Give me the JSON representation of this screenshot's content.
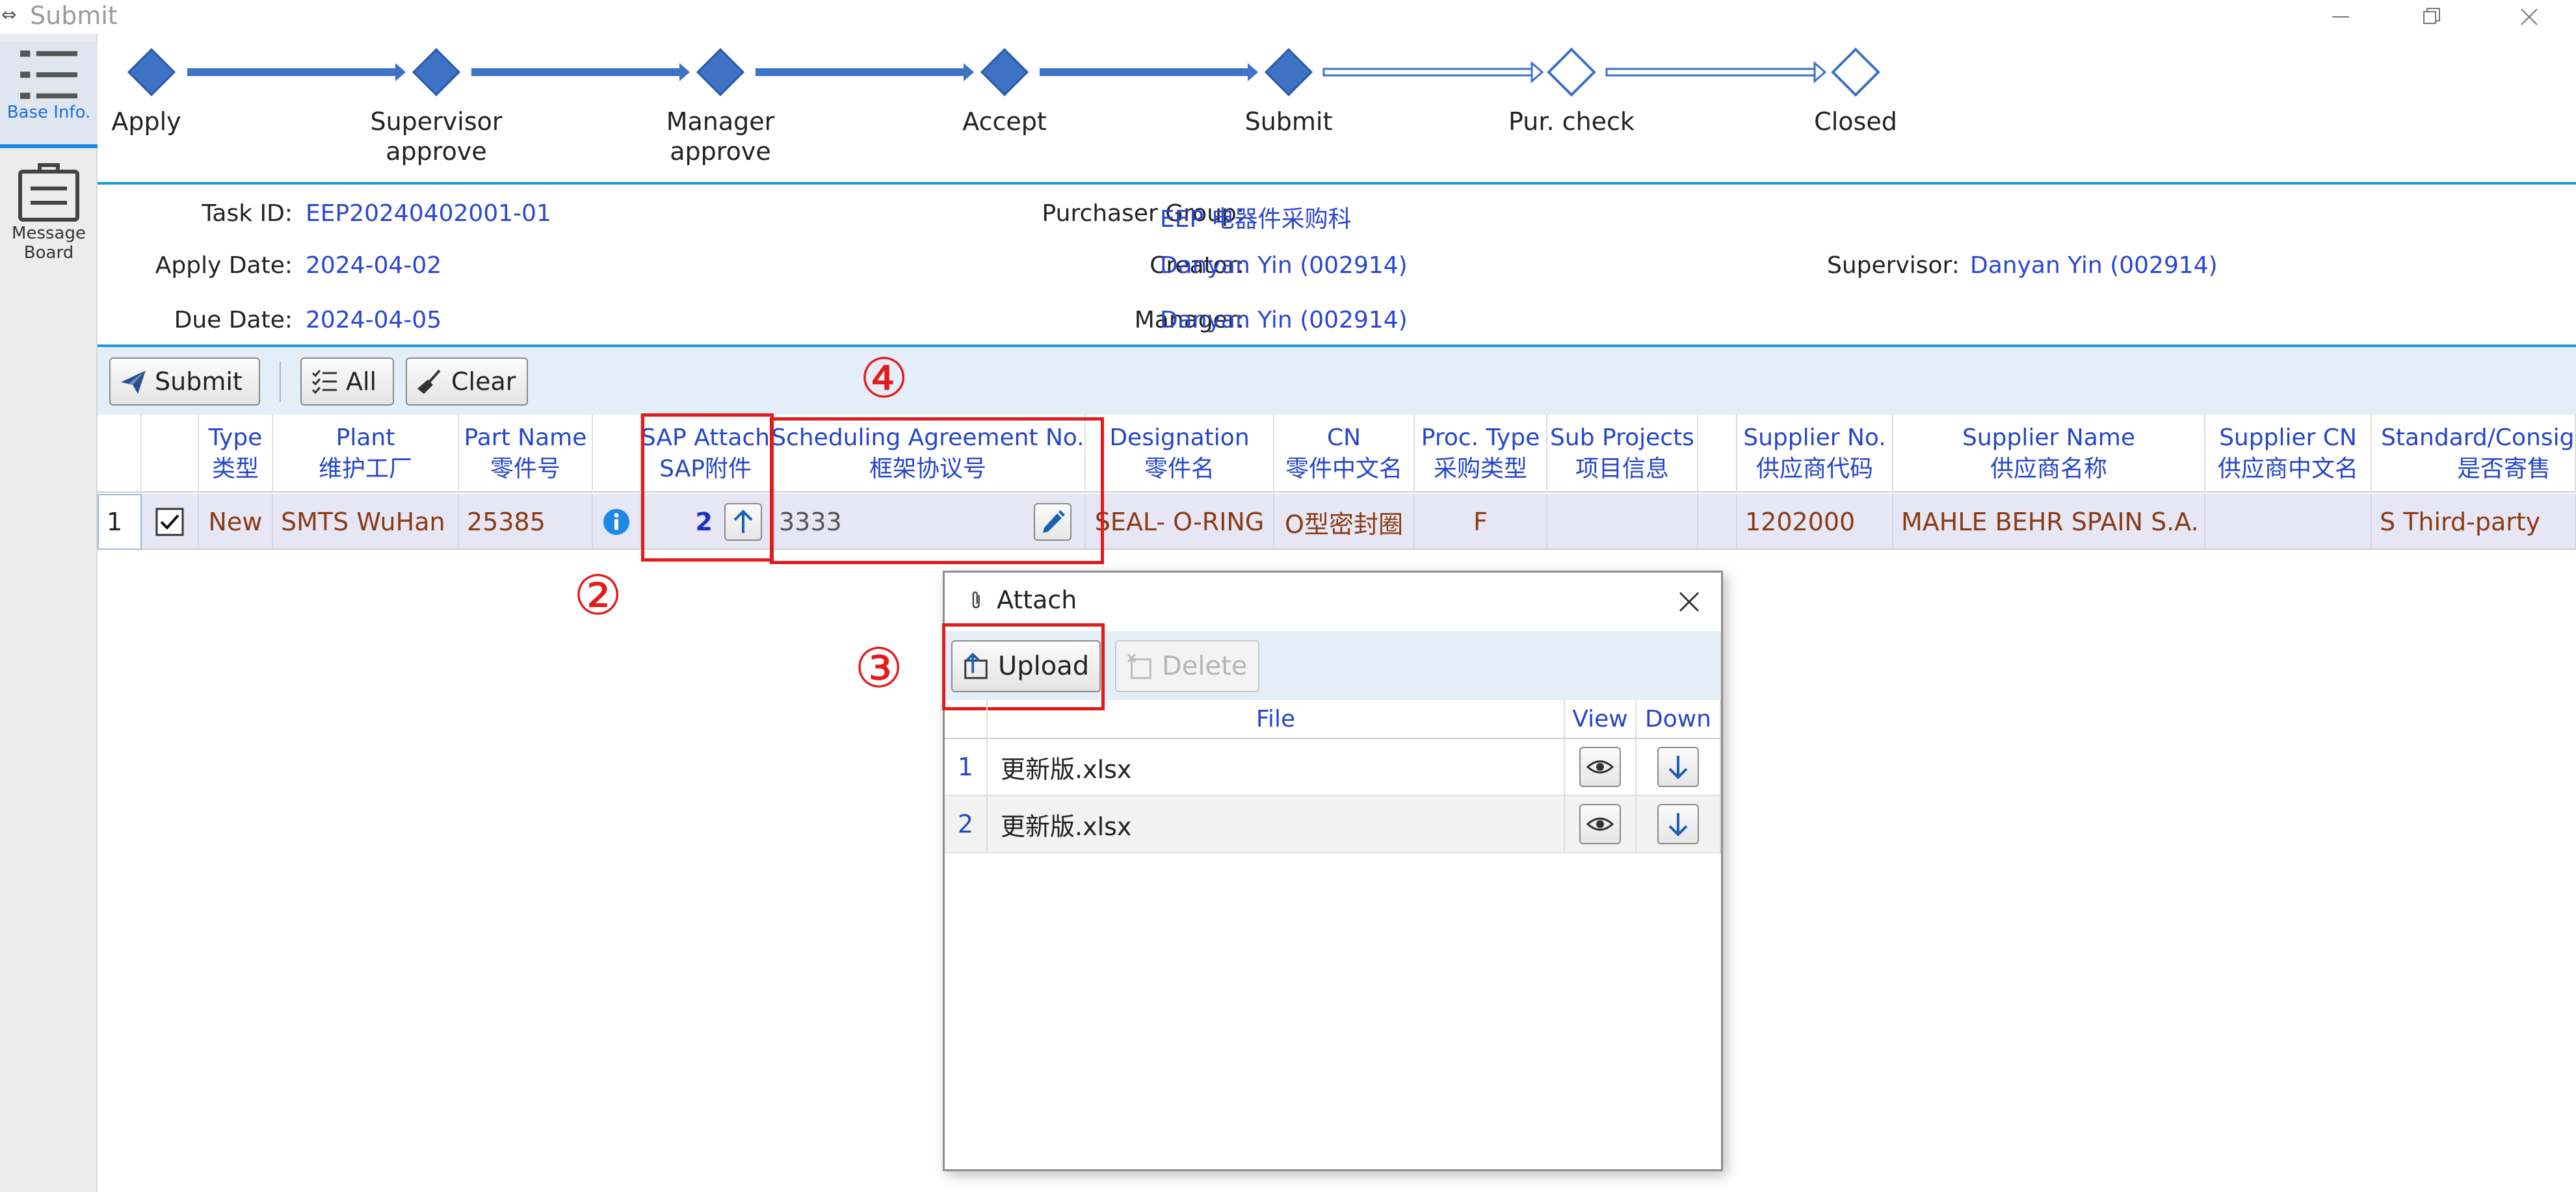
{
  "window": {
    "title": "Submit",
    "controls": [
      "minimize",
      "restore",
      "close"
    ]
  },
  "sidebar": {
    "items": [
      {
        "label": "Base Info.",
        "icon": "list-icon",
        "active": true
      },
      {
        "label": "Message\nBoard",
        "icon": "clipboard-icon",
        "active": false
      }
    ]
  },
  "workflow": {
    "steps": [
      {
        "label": "Apply",
        "done": true
      },
      {
        "label": "Supervisor\napprove",
        "done": true
      },
      {
        "label": "Manager\napprove",
        "done": true
      },
      {
        "label": "Accept",
        "done": true
      },
      {
        "label": "Submit",
        "done": true
      },
      {
        "label": "Pur. check",
        "done": false
      },
      {
        "label": "Closed",
        "done": false
      }
    ]
  },
  "info": {
    "task_id_label": "Task ID:",
    "task_id": "EEP20240402001-01",
    "apply_date_label": "Apply Date:",
    "apply_date": "2024-04-02",
    "due_date_label": "Due Date:",
    "due_date": "2024-04-05",
    "purchaser_group_label": "Purchaser Group:",
    "purchaser_group": "EEP 电器件采购科",
    "creator_label": "Creator:",
    "creator": "Danyan Yin (002914)",
    "manager_label": "Manager:",
    "manager": "Danyan Yin (002914)",
    "supervisor_label": "Supervisor:",
    "supervisor": "Danyan Yin (002914)"
  },
  "toolbar": {
    "submit_label": "Submit",
    "all_label": "All",
    "clear_label": "Clear"
  },
  "grid": {
    "columns": [
      {
        "key": "rownum",
        "line1": "",
        "line2": ""
      },
      {
        "key": "check",
        "line1": "",
        "line2": ""
      },
      {
        "key": "type",
        "line1": "Type",
        "line2": "类型"
      },
      {
        "key": "plant",
        "line1": "Plant",
        "line2": "维护工厂"
      },
      {
        "key": "part",
        "line1": "Part Name",
        "line2": "零件号"
      },
      {
        "key": "info",
        "line1": "",
        "line2": ""
      },
      {
        "key": "sap",
        "line1": "SAP Attach",
        "line2": "SAP附件"
      },
      {
        "key": "sched",
        "line1": "Scheduling Agreement No.",
        "line2": "框架协议号"
      },
      {
        "key": "desig",
        "line1": "Designation",
        "line2": "零件名"
      },
      {
        "key": "cn",
        "line1": "CN",
        "line2": "零件中文名"
      },
      {
        "key": "proc",
        "line1": "Proc. Type",
        "line2": "采购类型"
      },
      {
        "key": "sub",
        "line1": "Sub Projects",
        "line2": "项目信息"
      },
      {
        "key": "blank",
        "line1": "",
        "line2": ""
      },
      {
        "key": "supno",
        "line1": "Supplier No.",
        "line2": "供应商代码"
      },
      {
        "key": "supname",
        "line1": "Supplier Name",
        "line2": "供应商名称"
      },
      {
        "key": "supcn",
        "line1": "Supplier CN",
        "line2": "供应商中文名"
      },
      {
        "key": "std",
        "line1": "Standard/Consign",
        "line2": "是否寄售"
      }
    ],
    "rows": [
      {
        "rownum": "1",
        "checked": true,
        "type": "New",
        "plant": "SMTS WuHan",
        "part": "25385",
        "sap_count": "2",
        "sched": "3333",
        "desig": "SEAL- O-RING",
        "cn": "O型密封圈",
        "proc": "F",
        "sub": "",
        "supno": "1202000",
        "supname": "MAHLE BEHR SPAIN S.A.",
        "supcn": "",
        "std": "S Third-party"
      }
    ]
  },
  "annotations": {
    "n2": "②",
    "n3": "③",
    "n4": "④"
  },
  "dialog": {
    "title": "Attach",
    "upload_label": "Upload",
    "delete_label": "Delete",
    "columns": {
      "file": "File",
      "view": "View",
      "down": "Down"
    },
    "files": [
      {
        "num": "1",
        "name": "更新版.xlsx"
      },
      {
        "num": "2",
        "name": "更新版.xlsx"
      }
    ]
  },
  "colors": {
    "accent": "#1e9bd7",
    "link_blue": "#2a45d4",
    "step_fill": "#3d72c4",
    "annotation_red": "#e31b1b",
    "cell_brown": "#8a3b12"
  }
}
